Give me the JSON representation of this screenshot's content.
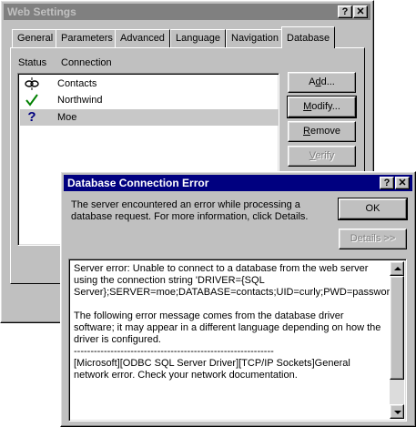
{
  "web_settings": {
    "title": "Web Settings",
    "help_glyph": "?",
    "close_glyph": "✕",
    "tabs": [
      {
        "label": "General"
      },
      {
        "label": "Parameters"
      },
      {
        "label": "Advanced"
      },
      {
        "label": "Language"
      },
      {
        "label": "Navigation"
      },
      {
        "label": "Database"
      }
    ],
    "active_tab": "Database",
    "columns": {
      "status": "Status",
      "connection": "Connection"
    },
    "connections": [
      {
        "name": "Contacts",
        "status_icon": "broken-link-icon"
      },
      {
        "name": "Northwind",
        "status_icon": "checkmark-icon"
      },
      {
        "name": "Moe",
        "status_icon": "question-icon",
        "selected": true
      }
    ],
    "buttons": {
      "add": {
        "pre": "A",
        "u": "d",
        "post": "d..."
      },
      "modify": {
        "pre": "",
        "u": "M",
        "post": "odify..."
      },
      "remove": {
        "pre": "",
        "u": "R",
        "post": "emove"
      },
      "verify": {
        "pre": "",
        "u": "V",
        "post": "erify"
      }
    },
    "checkmark_color": "#008000",
    "question_color": "#000080"
  },
  "error_dialog": {
    "title": "Database Connection Error",
    "help_glyph": "?",
    "close_glyph": "✕",
    "message": "The server encountered an error while processing a database request. For more information, click Details.",
    "ok_label": "OK",
    "details_label": "Details >>",
    "details_text": "Server error: Unable to connect to a database from the web server using the connection string 'DRIVER={SQL Server};SERVER=moe;DATABASE=contacts;UID=curly;PWD=password'.\n\nThe following error message comes from the database driver software; it may appear in a different language depending on how the driver is configured.\n------------------------------------------------------------\n[Microsoft][ODBC SQL Server Driver][TCP/IP Sockets]General network error. Check your network documentation."
  }
}
